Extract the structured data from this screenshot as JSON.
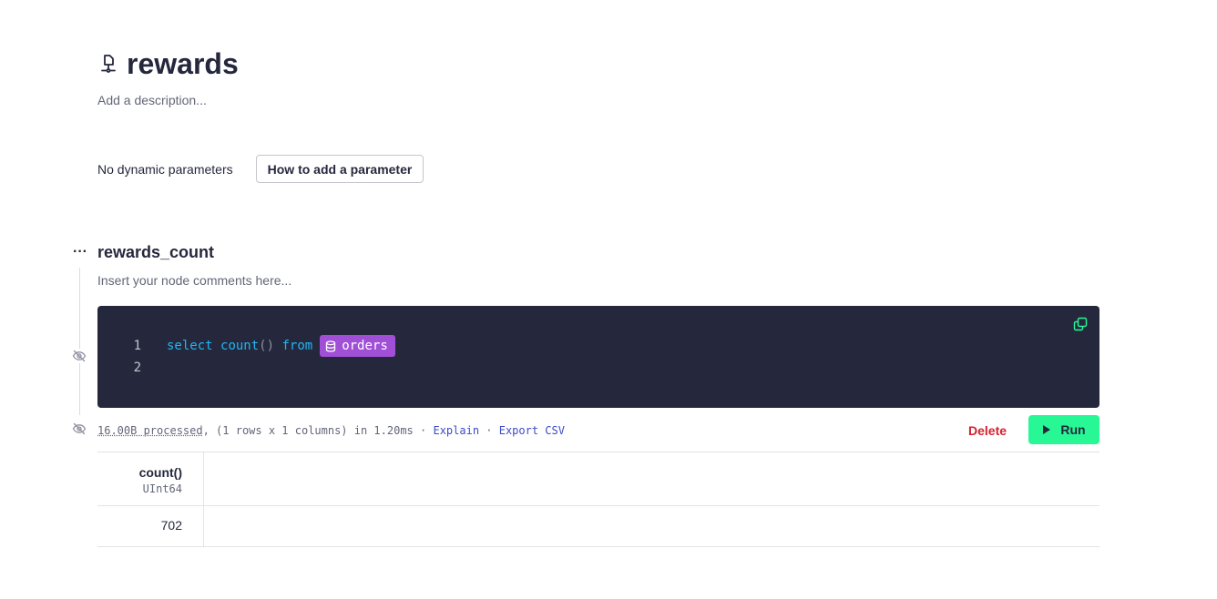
{
  "pipe": {
    "title": "rewards",
    "description_placeholder": "Add a description..."
  },
  "params": {
    "status": "No dynamic parameters",
    "help_button": "How to add a parameter"
  },
  "node": {
    "name": "rewards_count",
    "comments_placeholder": "Insert your node comments here...",
    "menu_label": "···",
    "code": {
      "line_numbers": [
        "1",
        "2"
      ],
      "kw_select": "select",
      "fn_count": "count",
      "parens": "()",
      "kw_from": "from",
      "datasource": "orders"
    },
    "stats": {
      "processed": "16.00B processed",
      "summary": ", (1 rows x 1 columns) in 1.20ms · ",
      "explain": "Explain",
      "separator": " · ",
      "export": "Export CSV"
    },
    "delete_label": "Delete",
    "run_label": "Run"
  },
  "result": {
    "columns": [
      {
        "name": "count()",
        "type": "UInt64"
      }
    ],
    "rows": [
      [
        "702"
      ]
    ]
  },
  "colors": {
    "editor_bg": "#25283d",
    "keyword": "#1fb6f1",
    "datasource_pill": "#a04fd6",
    "run_button": "#27f795",
    "delete": "#d61f2c",
    "link": "#3c4bca"
  }
}
